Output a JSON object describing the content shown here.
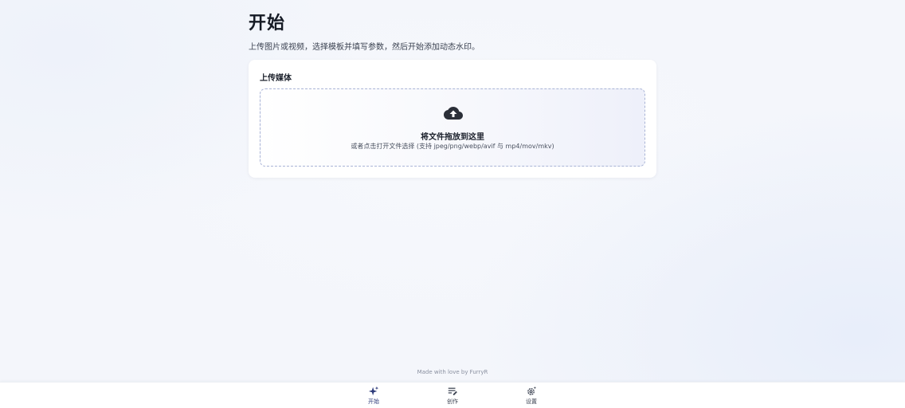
{
  "header": {
    "title": "开始",
    "subtitle": "上传图片或视频，选择模板并填写参数，然后开始添加动态水印。"
  },
  "upload_card": {
    "title": "上传媒体",
    "dropzone": {
      "icon": "cloud-upload-icon",
      "title": "将文件拖放到这里",
      "hint": "或者点击打开文件选择 (支持 jpeg/png/webp/avif 与 mp4/mov/mkv)"
    }
  },
  "footer": {
    "credit": "Made with love by FurryR"
  },
  "bottom_nav": {
    "items": [
      {
        "label": "开始",
        "icon": "sparkle-icon",
        "active": true
      },
      {
        "label": "创作",
        "icon": "edit-note-icon",
        "active": false
      },
      {
        "label": "设置",
        "icon": "settings-gear-icon",
        "active": false
      }
    ]
  },
  "colors": {
    "accent": "#2e3b7a",
    "dropzone_border": "#a9b4d6",
    "background": "#f4f6fb"
  }
}
